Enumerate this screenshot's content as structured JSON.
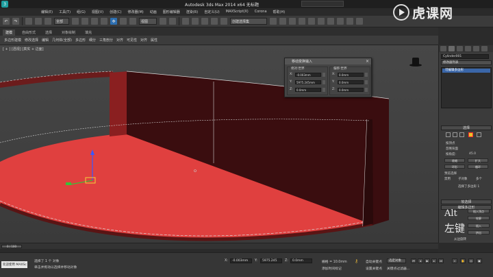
{
  "window": {
    "title": "Autodesk 3ds Max  2014 x64    无标题"
  },
  "menu": {
    "items": [
      "编辑(E)",
      "工具(T)",
      "组(G)",
      "视图(V)",
      "创建(C)",
      "修改器(M)",
      "动画",
      "图形编辑器",
      "渲染(R)",
      "自定义(U)",
      "MAXScript(X)",
      "Corona",
      "帮助(H)"
    ]
  },
  "toolbar": {
    "undo_label": "↶",
    "redo_label": "↷",
    "selection_filter": "全部",
    "view_coord": "视图",
    "named_selection": "创建选择集"
  },
  "ribbon": {
    "tabs": [
      "建模",
      "自由形式",
      "选择",
      "对象绘制",
      "填充"
    ],
    "active_tab": 0,
    "sub_items": [
      "多边形建模",
      "修改选择",
      "编辑",
      "几何体(全部)",
      "多边形",
      "细分",
      "三角剖分",
      "对齐",
      "可见性",
      "对齐",
      "属性"
    ]
  },
  "viewport": {
    "label": "[ + ] [透视] [真实 + 边面]"
  },
  "transform_dialog": {
    "title": "移动变换输入",
    "close": "×",
    "left_group": {
      "title": "绝对:世界",
      "x": "-0.003mm",
      "y": "5975.245mm",
      "z": "0.0mm"
    },
    "right_group": {
      "title": "偏移:世界",
      "x": "0.0mm",
      "y": "0.0mm",
      "z": "0.0mm"
    },
    "axis": {
      "x": "X:",
      "y": "Y:",
      "z": "Z:"
    }
  },
  "command_panel": {
    "object_name": "Cylinder001",
    "modifier_list": "修改器列表",
    "stack_item": "可编辑多边形",
    "selection_rollout": "选择",
    "by_vertex": "按顶点",
    "ignore_backfacing": "忽略背面",
    "by_angle": "按角度:",
    "angle_value": "45.0",
    "shrink": "收缩",
    "grow": "扩大",
    "ring": "环形",
    "loop": "循环",
    "preview_selection": "预览选择",
    "off": "禁用",
    "subobject": "子对象",
    "multi": "多个",
    "selected_status": "选择了多边形 1",
    "soft_selection": "软选择",
    "edit_polygons": "编辑多边形",
    "insert_vertex": "插入顶点",
    "extrude": "挤出",
    "outline": "轮廓",
    "bevel": "倒角",
    "inset": "插入",
    "glyph_alt": "Alt",
    "glyph_left_key": "左键",
    "from_edge": "从边旋转",
    "along_spline": "沿样条线挤出"
  },
  "timeline": {
    "slider": "0 / 100"
  },
  "status": {
    "welcome": "欢迎使用 MAXSc",
    "line1": "选择了 1 个 对象",
    "line2": "单击并拖动以选择并移动对象",
    "x_label": "X:",
    "x_value": "-0.003mm",
    "y_label": "Y:",
    "y_value": "5975.245",
    "z_label": "Z:",
    "z_value": "0.0mm",
    "grid": "栅格 = 10.0mm",
    "add_time_tag": "添加时间标记",
    "auto_key": "自动关键点",
    "selected_obj": "选定对象",
    "set_key": "设置关键点",
    "key_filter": "关键点过滤器..."
  },
  "watermark": {
    "text": "虎课网"
  }
}
